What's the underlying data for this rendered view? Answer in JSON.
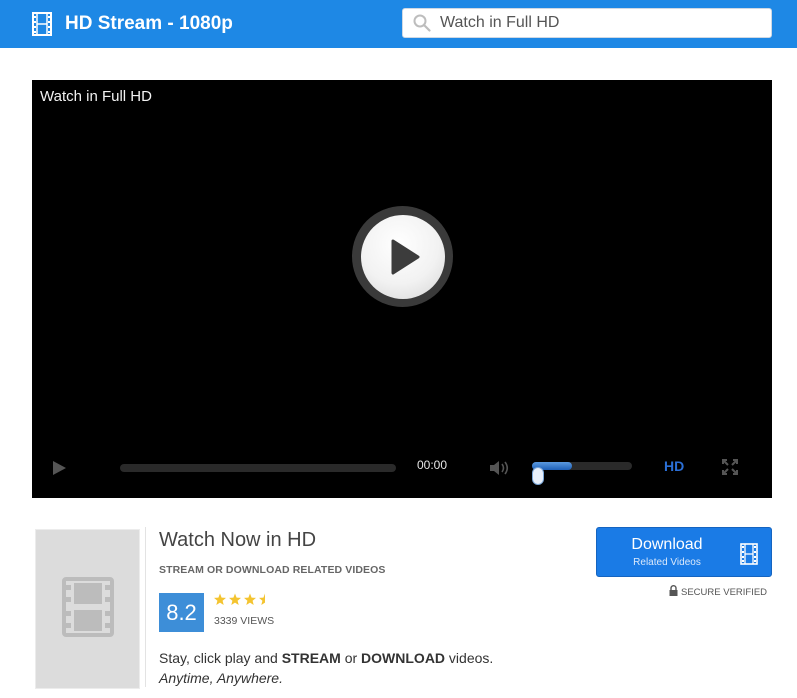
{
  "header": {
    "title": "HD Stream - 1080p",
    "search_placeholder": "Watch in Full HD",
    "icons": {
      "brand": "film-icon",
      "search": "search-icon"
    }
  },
  "player": {
    "overlay_title": "Watch in Full HD",
    "time": "00:00",
    "progress": 0,
    "volume": 0.4,
    "hd_label": "HD",
    "icons": {
      "big_play": "play-icon",
      "play": "play-icon",
      "volume": "volume-icon",
      "fullscreen": "fullscreen-icon"
    }
  },
  "info": {
    "title": "Watch Now in HD",
    "subtitle": "STREAM OR DOWNLOAD RELATED VIDEOS",
    "rating": "8.2",
    "stars": 3.5,
    "views": "3339 VIEWS",
    "desc": {
      "prefix": "Stay, click play and ",
      "strong1": "STREAM",
      "middle": " or ",
      "strong2": "DOWNLOAD",
      "suffix": " videos."
    },
    "desc_line2": "Anytime, Anywhere."
  },
  "download": {
    "label": "Download",
    "sublabel": "Related Videos",
    "secure_text": "SECURE VERIFIED"
  },
  "colors": {
    "header_bg": "#1e88e5",
    "button_bg": "#1a7be6",
    "rating_bg": "#3d8ed8",
    "star": "#f4c430",
    "hd": "#2b6fd6"
  }
}
